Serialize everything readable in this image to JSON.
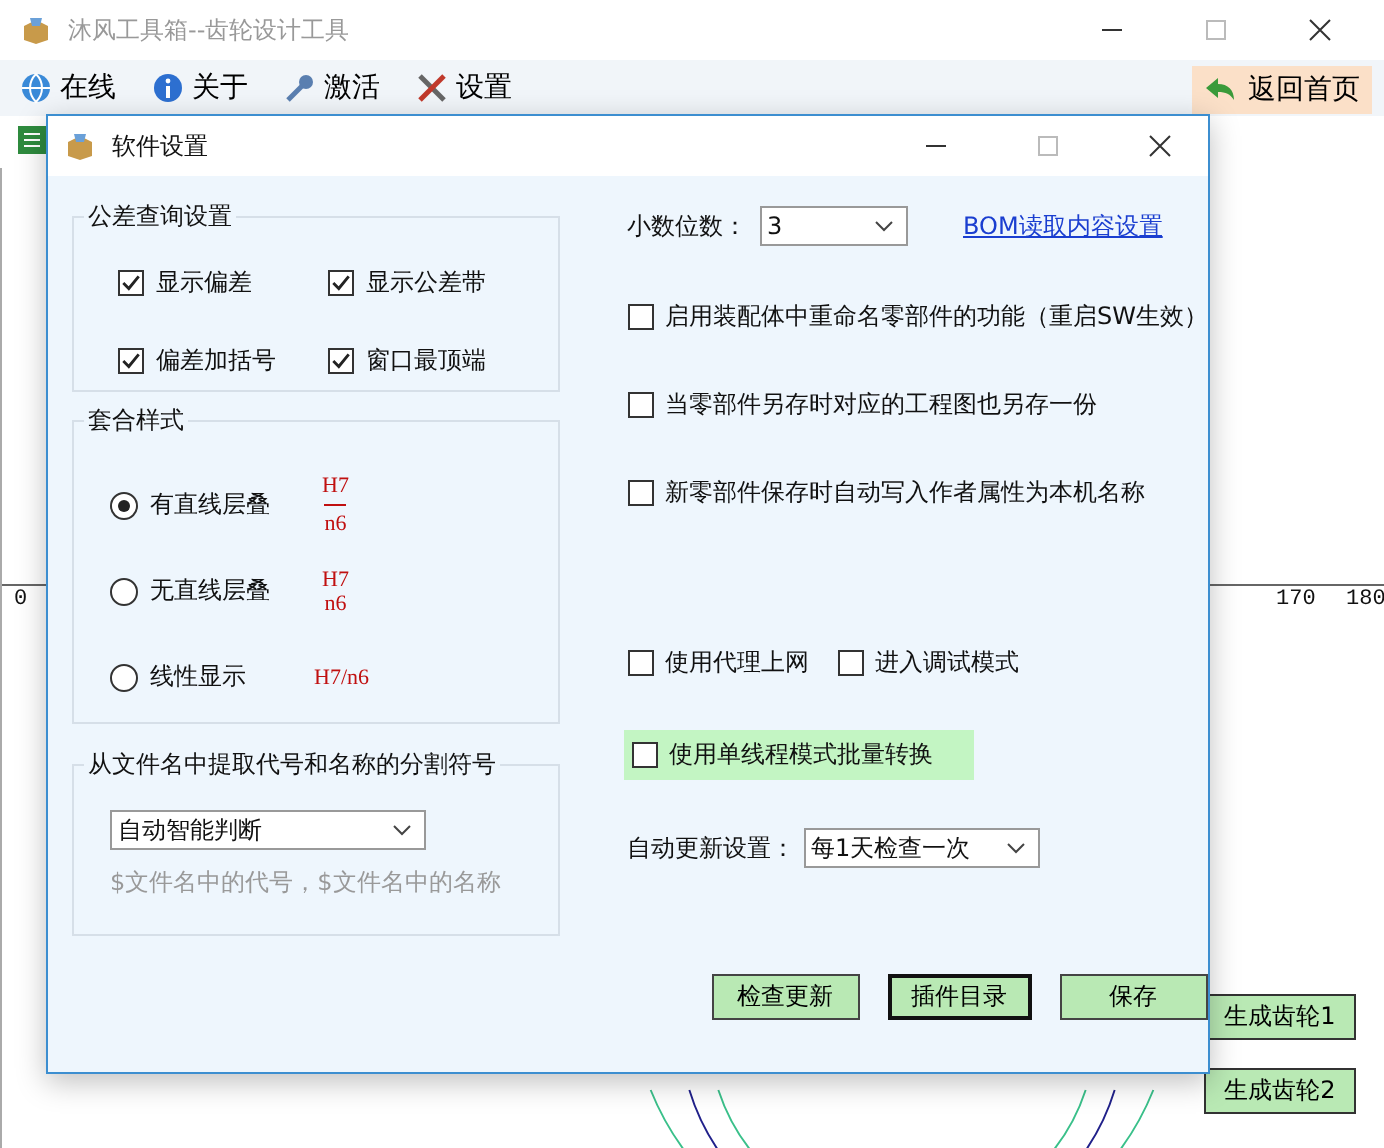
{
  "window": {
    "title": "沐风工具箱--齿轮设计工具"
  },
  "toolbar": [
    {
      "label": "在线"
    },
    {
      "label": "关于"
    },
    {
      "label": "激活"
    },
    {
      "label": "设置"
    }
  ],
  "back_button": {
    "label": "返回首页"
  },
  "axis": {
    "ticks": [
      "0",
      "170",
      "180"
    ]
  },
  "side_buttons": [
    "生成齿轮1",
    "生成齿轮2"
  ],
  "dialog": {
    "title": "软件设置",
    "tolerance_group": {
      "title": "公差查询设置",
      "options": [
        {
          "label": "显示偏差",
          "checked": true
        },
        {
          "label": "显示公差带",
          "checked": true
        },
        {
          "label": "偏差加括号",
          "checked": true
        },
        {
          "label": "窗口最顶端",
          "checked": true
        }
      ]
    },
    "fit_group": {
      "title": "套合样式",
      "options": [
        {
          "label": "有直线层叠",
          "selected": true,
          "kind": "fraction_line",
          "upper": "H7",
          "lower": "n6"
        },
        {
          "label": "无直线层叠",
          "selected": false,
          "kind": "fraction",
          "upper": "H7",
          "lower": "n6"
        },
        {
          "label": "线性显示",
          "selected": false,
          "kind": "inline",
          "text": "H7/n6"
        }
      ]
    },
    "separator_group": {
      "title": "从文件名中提取代号和名称的分割符号",
      "value": "自动智能判断",
      "hint": "$文件名中的代号，$文件名中的名称"
    },
    "decimal": {
      "label": "小数位数：",
      "value": "3"
    },
    "bom_link": "BOM读取内容设置",
    "option_rows": [
      [
        {
          "label": "启用装配体中重命名零部件的功能（重启SW生效）",
          "checked": false,
          "highlighted": false
        }
      ],
      [
        {
          "label": "当零部件另存时对应的工程图也另存一份",
          "checked": false,
          "highlighted": false
        }
      ],
      [
        {
          "label": "新零部件保存时自动写入作者属性为本机名称",
          "checked": false,
          "highlighted": false
        }
      ],
      [
        {
          "label": "使用代理上网",
          "checked": false,
          "highlighted": false
        },
        {
          "label": "进入调试模式",
          "checked": false,
          "highlighted": false
        }
      ],
      [
        {
          "label": "使用单线程模式批量转换",
          "checked": false,
          "highlighted": true
        }
      ]
    ],
    "update": {
      "label": "自动更新设置：",
      "value": "每1天检查一次"
    },
    "buttons": [
      {
        "label": "检查更新",
        "default": false
      },
      {
        "label": "插件目录",
        "default": true
      },
      {
        "label": "保存",
        "default": false
      }
    ]
  }
}
